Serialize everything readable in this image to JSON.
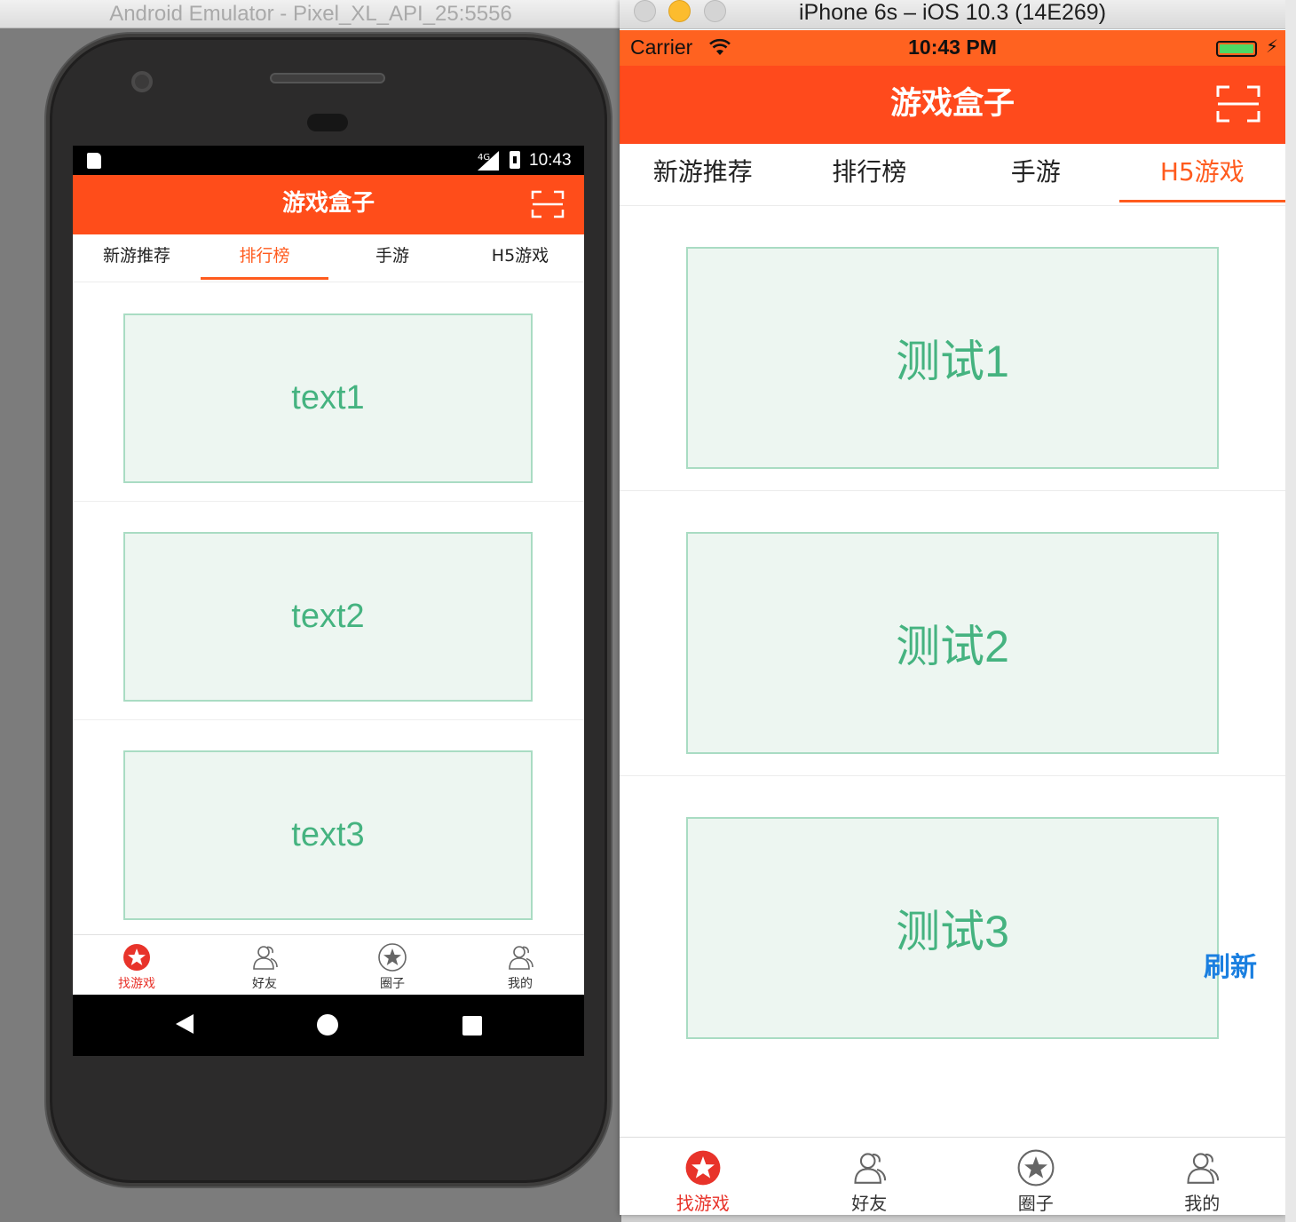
{
  "android": {
    "window_title": "Android Emulator - Pixel_XL_API_25:5556",
    "status": {
      "network": "4G",
      "time": "10:43"
    },
    "app_title": "游戏盒子",
    "tabs": [
      {
        "label": "新游推荐",
        "active": false
      },
      {
        "label": "排行榜",
        "active": true
      },
      {
        "label": "手游",
        "active": false
      },
      {
        "label": "H5游戏",
        "active": false
      }
    ],
    "cards": [
      "text1",
      "text2",
      "text3"
    ],
    "tabbar": [
      {
        "label": "找游戏",
        "icon": "star-circle-icon",
        "active": true
      },
      {
        "label": "好友",
        "icon": "friends-icon",
        "active": false
      },
      {
        "label": "圈子",
        "icon": "star-outline-icon",
        "active": false
      },
      {
        "label": "我的",
        "icon": "profile-icon",
        "active": false
      }
    ]
  },
  "ios": {
    "window_title": "iPhone 6s – iOS 10.3 (14E269)",
    "status": {
      "carrier": "Carrier",
      "time": "10:43 PM"
    },
    "app_title": "游戏盒子",
    "tabs": [
      {
        "label": "新游推荐",
        "active": false
      },
      {
        "label": "排行榜",
        "active": false
      },
      {
        "label": "手游",
        "active": false
      },
      {
        "label": "H5游戏",
        "active": true
      }
    ],
    "cards": [
      "测试1",
      "测试2",
      "测试3"
    ],
    "refresh_label": "刷新",
    "tabbar": [
      {
        "label": "找游戏",
        "icon": "star-circle-icon",
        "active": true
      },
      {
        "label": "好友",
        "icon": "friends-icon",
        "active": false
      },
      {
        "label": "圈子",
        "icon": "star-outline-icon",
        "active": false
      },
      {
        "label": "我的",
        "icon": "profile-icon",
        "active": false
      }
    ]
  },
  "colors": {
    "brand_orange": "#ff4d1a",
    "tab_active": "#ff5b1e",
    "card_text": "#45b380",
    "card_border": "#a9dcc3",
    "card_bg": "#edf6f1",
    "tabbar_active": "#e8332a",
    "refresh": "#1a7fe0"
  }
}
